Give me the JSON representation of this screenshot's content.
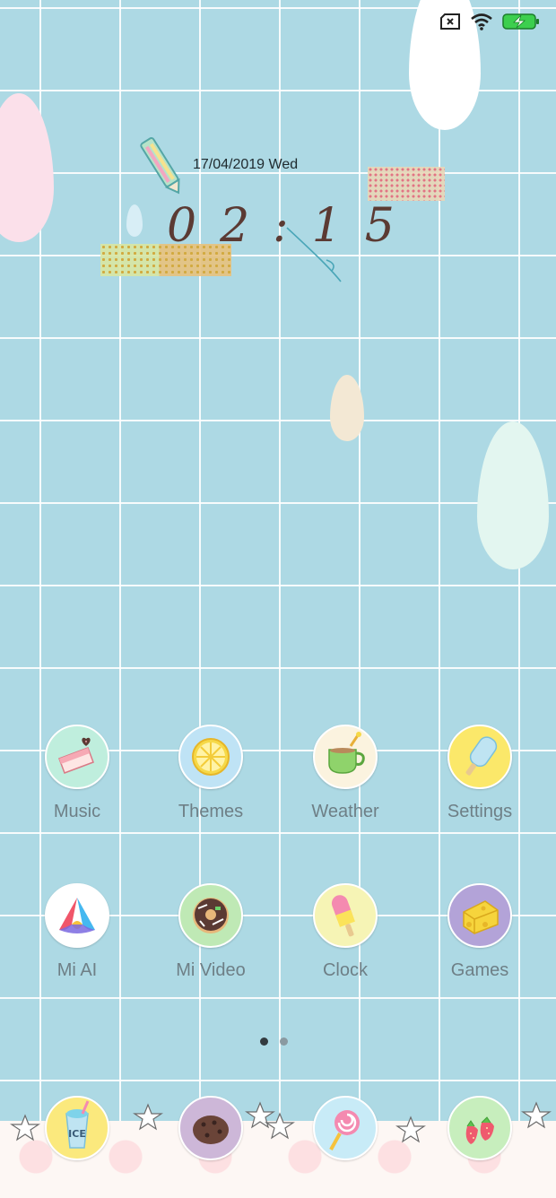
{
  "status_bar": {
    "icons": [
      "no-sim-icon",
      "wifi-icon",
      "battery-charging-icon"
    ],
    "battery_color": "#3ccf4e"
  },
  "clock_widget": {
    "date": "17/04/2019 Wed",
    "time": "02:15"
  },
  "apps": [
    {
      "label": "Music",
      "icon": "strawberry-cake-icon",
      "bg": "#bfeedd"
    },
    {
      "label": "Themes",
      "icon": "lemon-slice-icon",
      "bg": "#bfe3f5"
    },
    {
      "label": "Weather",
      "icon": "tea-cup-icon",
      "bg": "#fbf3df"
    },
    {
      "label": "Settings",
      "icon": "popsicle-icon",
      "bg": "#fbe86a"
    },
    {
      "label": "Mi AI",
      "icon": "mi-ai-logo-icon",
      "bg": "#ffffff"
    },
    {
      "label": "Mi Video",
      "icon": "donut-icon",
      "bg": "#bfe9b5"
    },
    {
      "label": "Clock",
      "icon": "ice-pop-icon",
      "bg": "#f6f4b5"
    },
    {
      "label": "Games",
      "icon": "cheese-icon",
      "bg": "#b3a3d8"
    }
  ],
  "page_indicator": {
    "pages": 2,
    "current": 1
  },
  "dock": [
    {
      "icon": "ice-drink-icon",
      "text": "ICE",
      "bg": "#fbe97d"
    },
    {
      "icon": "cookie-icon",
      "bg": "#cdb7d8"
    },
    {
      "icon": "lollipop-icon",
      "bg": "#c8ebf7"
    },
    {
      "icon": "strawberries-icon",
      "bg": "#c7eebd"
    }
  ]
}
